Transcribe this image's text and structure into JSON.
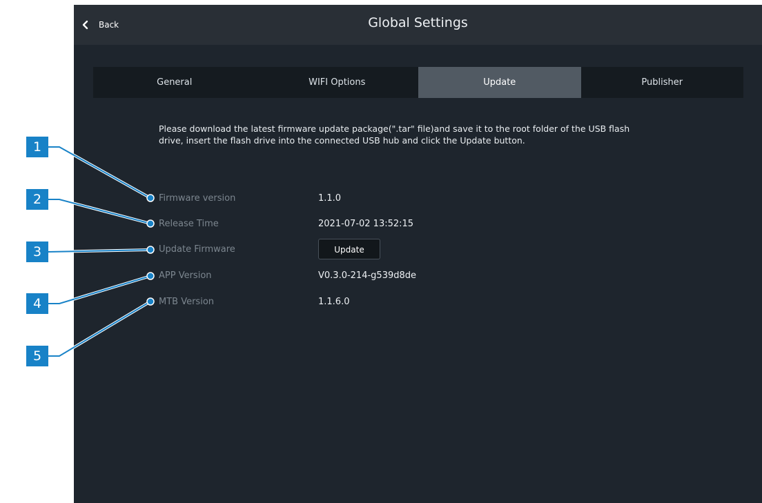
{
  "header": {
    "back_label": "Back",
    "title": "Global Settings"
  },
  "tabs": [
    {
      "label": "General",
      "active": false
    },
    {
      "label": "WIFI Options",
      "active": false
    },
    {
      "label": "Update",
      "active": true
    },
    {
      "label": "Publisher",
      "active": false
    }
  ],
  "update_panel": {
    "description_line1": "Please download the latest firmware update package(\".tar\" file)and save it to the root folder of the USB flash",
    "description_line2": "drive, insert the flash drive into the connected USB hub and click the Update button.",
    "rows": [
      {
        "label": "Firmware version",
        "value": "1.1.0"
      },
      {
        "label": "Release Time",
        "value": "2021-07-02 13:52:15"
      },
      {
        "label": "Update Firmware",
        "button_label": "Update"
      },
      {
        "label": "APP Version",
        "value": "V0.3.0-214-g539d8de"
      },
      {
        "label": "MTB Version",
        "value": "1.1.6.0"
      }
    ]
  },
  "callouts": [
    "1",
    "2",
    "3",
    "4",
    "5"
  ],
  "colors": {
    "screen_bg": "#1e252d",
    "topbar_bg": "#292f36",
    "active_tab_bg": "#515a63",
    "callout_blue": "#1882c7"
  }
}
